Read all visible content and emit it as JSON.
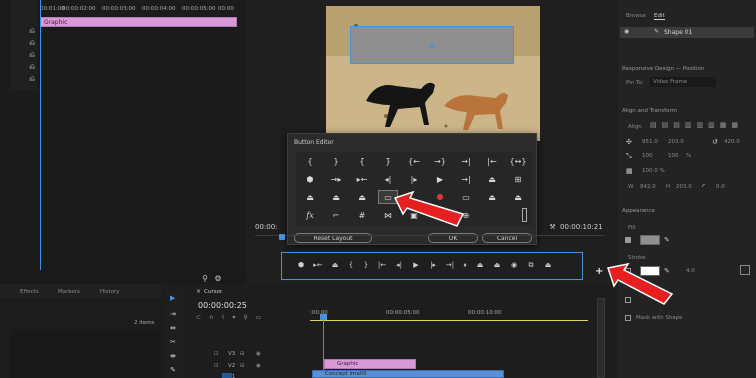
{
  "colors": {
    "accent": "#4a8fe0",
    "clip_pink": "#d79ad6",
    "clip_blue": "#5a8fd6",
    "record": "#e03838",
    "arrow": "#e81f1f",
    "yellow": "#e2d45a"
  },
  "source_timeline": {
    "timecodes": [
      "00:01:00",
      "00:00:02:00",
      "00:00:03:00",
      "00:00:04:00",
      "00:00:05:00",
      "00:00"
    ],
    "clip_label": "Graphic"
  },
  "essential_graphics": {
    "tabs": [
      "Browse",
      "Edit"
    ],
    "layer_name": "Shape 01",
    "responsive_label": "Responsive Design — Position",
    "pin_to_label": "Pin To:",
    "pin_to_value": "Video Frame",
    "align_label": "Align and Transform",
    "align_sub": "Align",
    "pos_x": "951.0",
    "pos_y": "203.0",
    "rotation": "420.0",
    "scale_a": "100",
    "scale_b": "100",
    "percent": "%",
    "opacity": "100.0 %",
    "w_label": "W",
    "w_value": "842.0",
    "h_label": "H",
    "h_value": "203.0",
    "corner_value": "0.0",
    "appearance_label": "Appearance",
    "fill_label": "Fill",
    "stroke_label": "Stroke",
    "stroke_value": "4.0",
    "mask_label": "Mask with Shape"
  },
  "program_monitor": {
    "timecode_left": "00:00:",
    "timecode_right": "00:00:10:21"
  },
  "button_editor": {
    "title": "Button Editor",
    "rows": [
      [
        "{",
        "}",
        "{̄",
        "}̄",
        "{←",
        "→}",
        "→|",
        "|←",
        "{↔}"
      ],
      [
        "⬢",
        "→▸",
        "▸←",
        "◂|",
        "|▸",
        "▶",
        "→|",
        "⏏",
        "⊞"
      ],
      [
        "⏏",
        "⏏",
        "⏏",
        "▭",
        "",
        "●",
        "▭",
        "⏏",
        "⏏"
      ],
      [
        "fx",
        "⌐",
        "#",
        "⋈",
        "▣",
        "",
        "⊕",
        "",
        ""
      ]
    ],
    "reset_label": "Reset Layout",
    "ok_label": "OK",
    "cancel_label": "Cancel"
  },
  "transport_icons": [
    "⬢",
    "▸←",
    "⏏",
    "{",
    "}",
    "|←",
    "◂|",
    "▶",
    "|▸",
    "→|",
    "⏸",
    "⏏",
    "⏏",
    "◉",
    "⧉",
    "⏏"
  ],
  "plus_symbol": "+",
  "project_panel": {
    "tabs": [
      "Effects",
      "Markers",
      "History"
    ],
    "items_count": "2 items"
  },
  "sequence": {
    "tab": "Cursor",
    "timecode": "00:00:00:25",
    "ruler": [
      ":00:00",
      "00:00:05:00",
      "00:00:10:00"
    ],
    "tracks": [
      "V3",
      "V2",
      "V1"
    ],
    "clip_graphic": "Graphic",
    "clip_second": "Concept ima00"
  }
}
